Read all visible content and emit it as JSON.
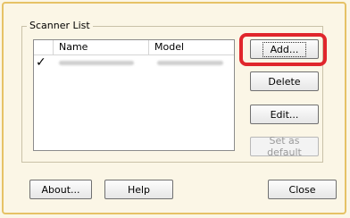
{
  "scanner_list": {
    "title": "Scanner List",
    "columns": [
      "Name",
      "Model"
    ],
    "rows": [
      {
        "checked": "✓"
      }
    ]
  },
  "side_buttons": {
    "add": "Add...",
    "delete": "Delete",
    "edit": "Edit...",
    "set_default": "Set as default"
  },
  "bottom_buttons": {
    "about": "About...",
    "help": "Help",
    "close": "Close"
  },
  "colors": {
    "highlight": "#e0262c",
    "background": "#fbf6e6"
  }
}
